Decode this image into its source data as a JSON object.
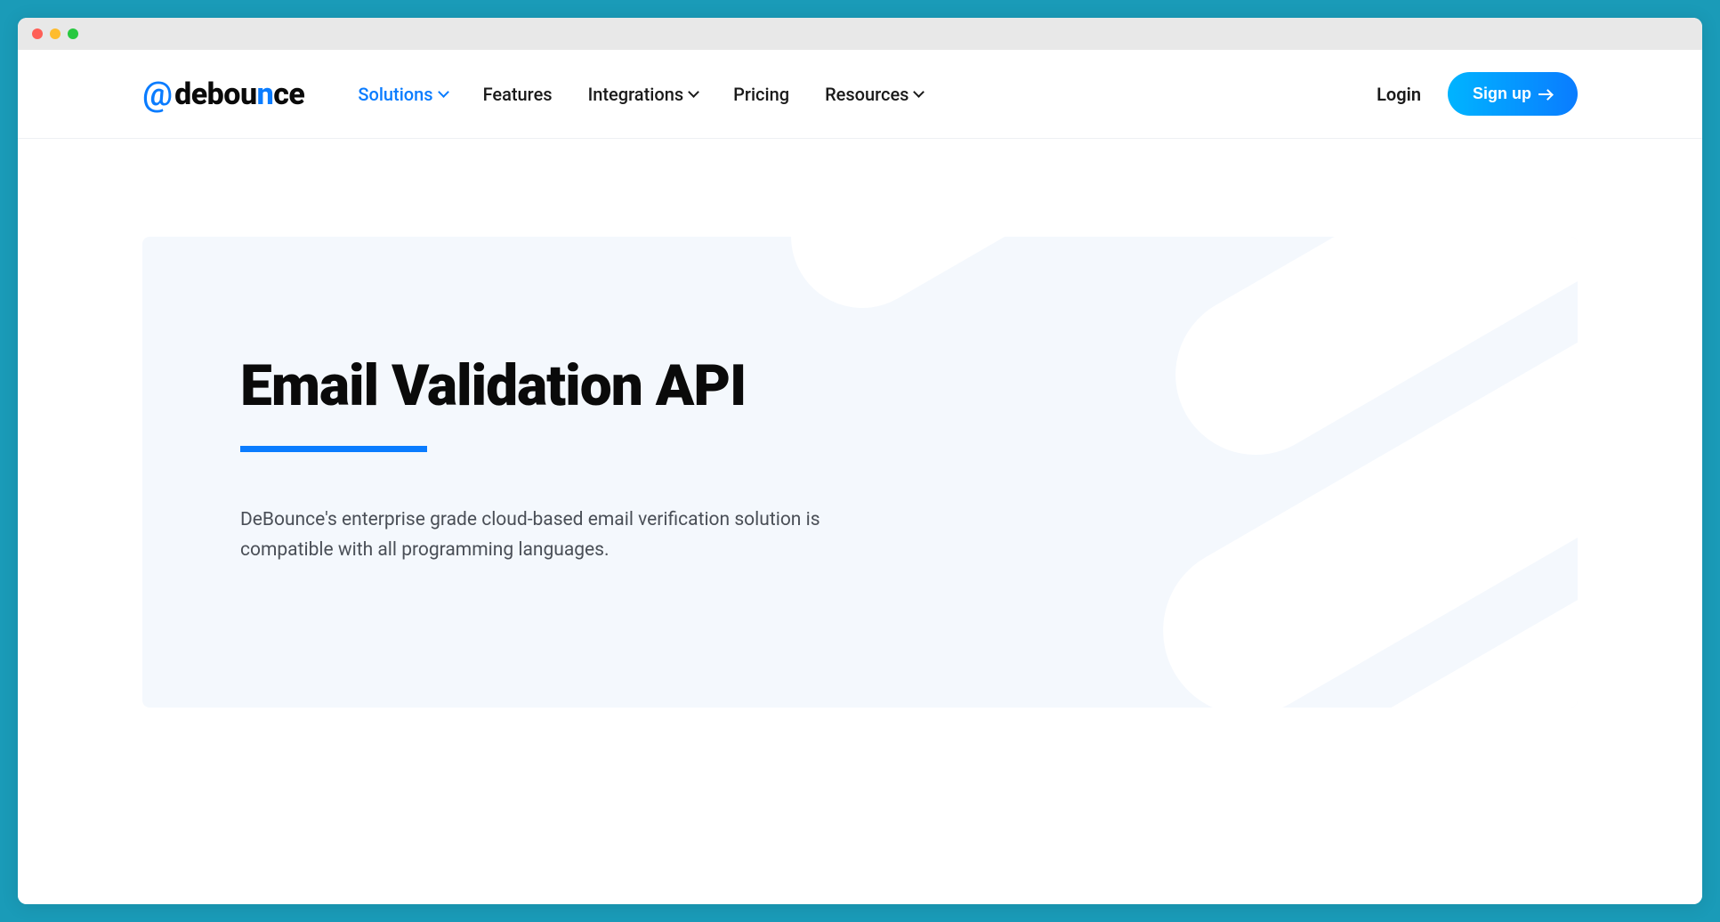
{
  "logo": {
    "prefix": "@",
    "part1": "debou",
    "part2": "n",
    "part3": "ce"
  },
  "nav": {
    "items": [
      {
        "label": "Solutions",
        "hasDropdown": true,
        "active": true
      },
      {
        "label": "Features",
        "hasDropdown": false,
        "active": false
      },
      {
        "label": "Integrations",
        "hasDropdown": true,
        "active": false
      },
      {
        "label": "Pricing",
        "hasDropdown": false,
        "active": false
      },
      {
        "label": "Resources",
        "hasDropdown": true,
        "active": false
      }
    ]
  },
  "header": {
    "login": "Login",
    "signup": "Sign up"
  },
  "hero": {
    "title": "Email Validation API",
    "description": "DeBounce's enterprise grade cloud-based email verification solution is compatible with all programming languages."
  },
  "colors": {
    "accent": "#0a7cff",
    "background": "#1a9bb8",
    "heroBg": "#f4f8fd"
  }
}
